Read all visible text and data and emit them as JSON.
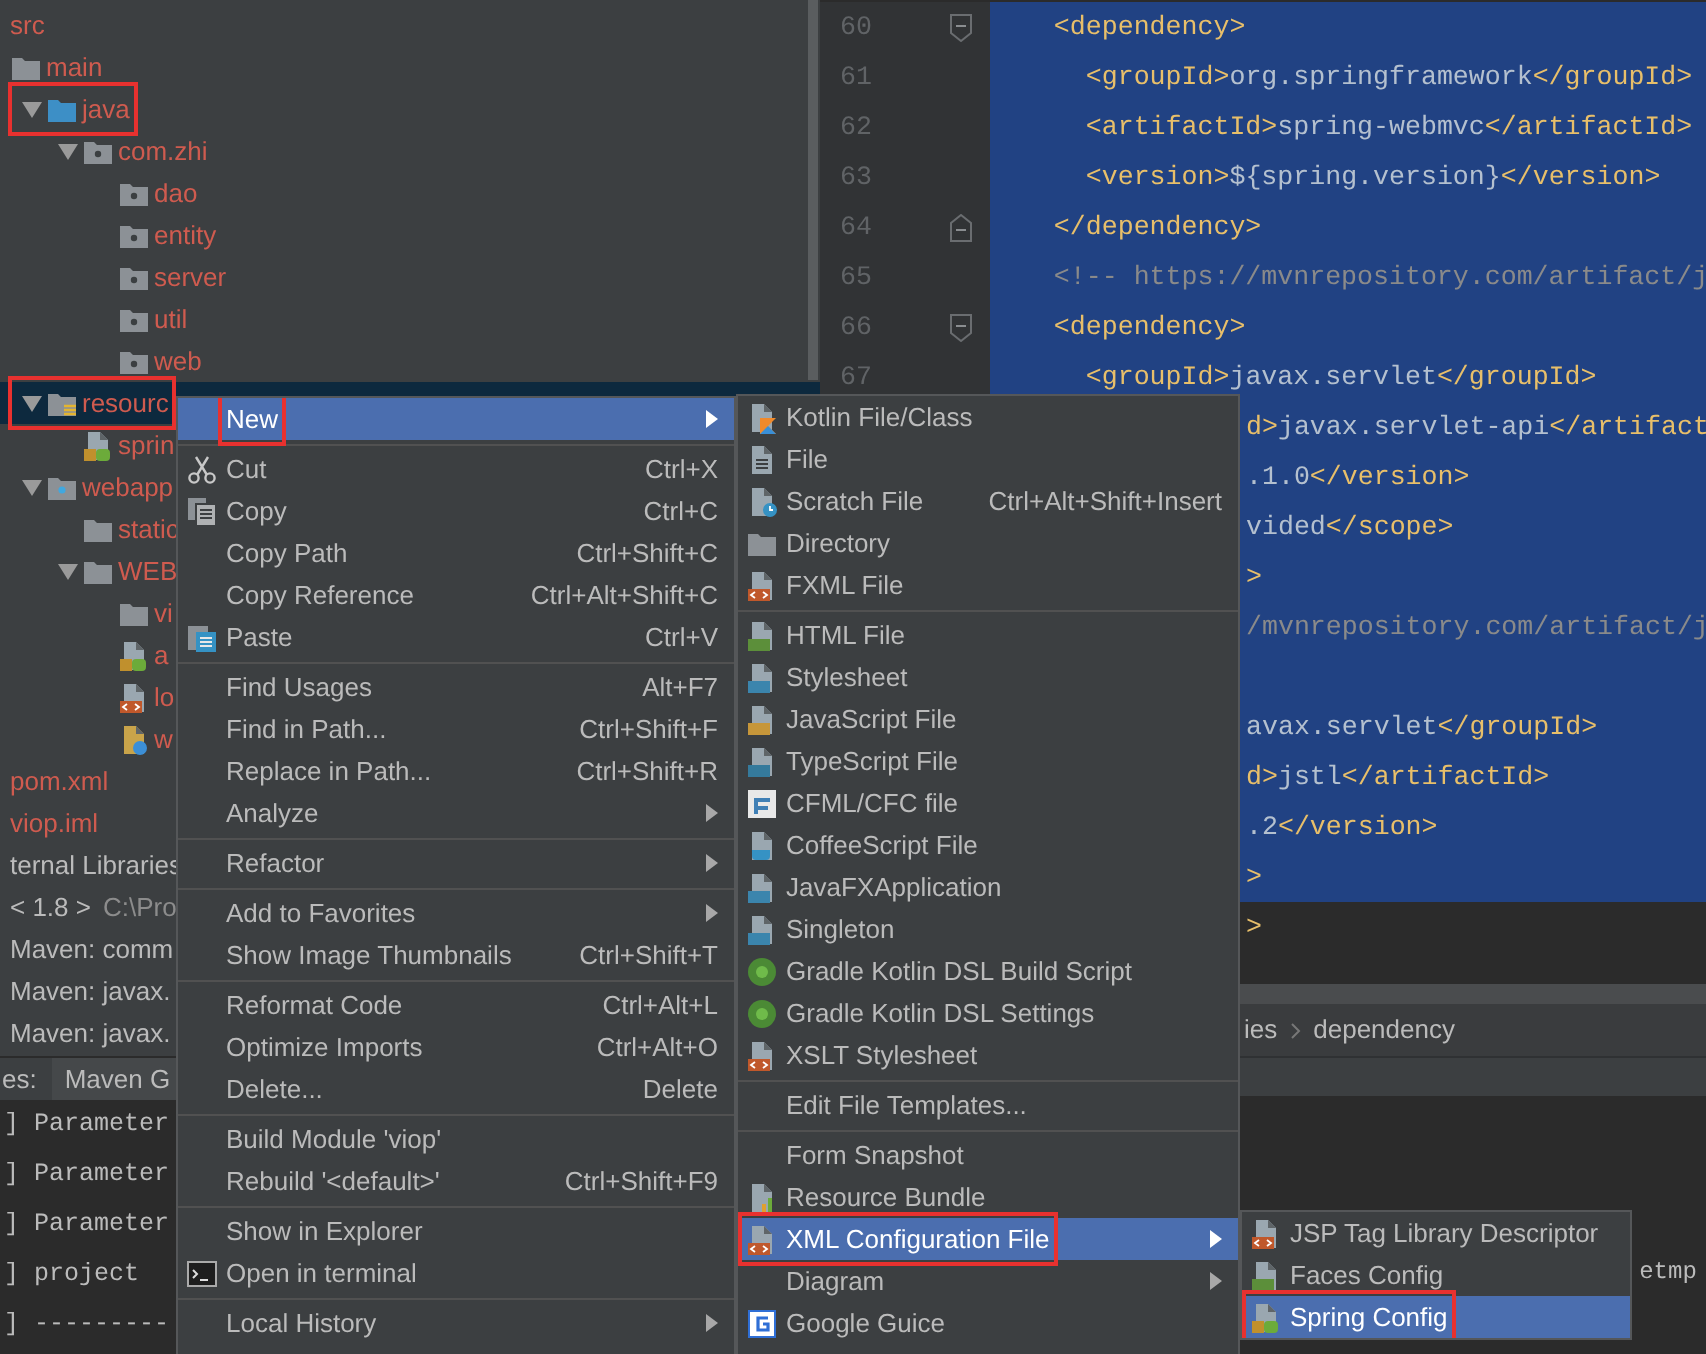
{
  "project_tree": {
    "items": [
      {
        "label": "src",
        "ignored": true,
        "selected": false,
        "boxed": false,
        "children": [
          {
            "label": "main",
            "kind": "folder",
            "ignored": true,
            "selected": false,
            "boxed": false,
            "children": [
              {
                "label": "java",
                "kind": "source",
                "ignored": true,
                "selected": false,
                "boxed": true,
                "children": [
                  {
                    "label": "com.zhi",
                    "kind": "package",
                    "ignored": true,
                    "selected": false,
                    "boxed": false,
                    "children": [
                      {
                        "label": "dao",
                        "kind": "package",
                        "ignored": true,
                        "selected": false,
                        "boxed": false
                      },
                      {
                        "label": "entity",
                        "kind": "package",
                        "ignored": true,
                        "selected": false,
                        "boxed": false
                      },
                      {
                        "label": "server",
                        "kind": "package",
                        "ignored": true,
                        "selected": false,
                        "boxed": false
                      },
                      {
                        "label": "util",
                        "kind": "package",
                        "ignored": true,
                        "selected": false,
                        "boxed": false
                      },
                      {
                        "label": "web",
                        "kind": "package",
                        "ignored": true,
                        "selected": false,
                        "boxed": false
                      }
                    ]
                  }
                ]
              },
              {
                "label": "resourc",
                "kind": "resources",
                "ignored": true,
                "selected": true,
                "boxed": true,
                "children": [
                  {
                    "label": "sprin",
                    "kind": "spring-xml",
                    "ignored": true,
                    "selected": false,
                    "boxed": false
                  }
                ]
              },
              {
                "label": "webapp",
                "kind": "web-folder",
                "ignored": true,
                "selected": false,
                "boxed": false,
                "children": [
                  {
                    "label": "static",
                    "kind": "folder",
                    "ignored": true,
                    "selected": false,
                    "boxed": false
                  },
                  {
                    "label": "WEB",
                    "kind": "folder",
                    "ignored": true,
                    "selected": false,
                    "boxed": false,
                    "children": [
                      {
                        "label": "vi",
                        "kind": "folder",
                        "ignored": true,
                        "selected": false,
                        "boxed": false
                      },
                      {
                        "label": "a",
                        "kind": "spring-xml",
                        "ignored": true,
                        "selected": false,
                        "boxed": false
                      },
                      {
                        "label": "lo",
                        "kind": "xml",
                        "ignored": true,
                        "selected": false,
                        "boxed": false
                      },
                      {
                        "label": "w",
                        "kind": "web-xml",
                        "ignored": true,
                        "selected": false,
                        "boxed": false
                      }
                    ]
                  }
                ]
              }
            ]
          }
        ]
      },
      {
        "label": "pom.xml",
        "ignored": true,
        "selected": false,
        "boxed": false
      },
      {
        "label": "viop.iml",
        "ignored": true,
        "selected": false,
        "boxed": false
      },
      {
        "label": "ternal Libraries",
        "ignored": false,
        "selected": false,
        "boxed": false
      },
      {
        "label": "< 1.8 >",
        "detail": "C:\\Pro",
        "ignored": false,
        "selected": false,
        "boxed": false
      },
      {
        "label": "Maven: comm",
        "ignored": false,
        "selected": false,
        "boxed": false
      },
      {
        "label": "Maven: javax.",
        "ignored": false,
        "selected": false,
        "boxed": false
      },
      {
        "label": "Maven: javax.",
        "ignored": false,
        "selected": false,
        "boxed": false
      }
    ]
  },
  "tool_tabs": {
    "prefix": "es:",
    "tab": "Maven G"
  },
  "editor": {
    "lines": [
      {
        "number": "60",
        "fold_start": true,
        "kind": "code",
        "text": "    <dependency>",
        "selected": true
      },
      {
        "number": "61",
        "kind": "code",
        "text": "      <groupId>org.springframework</groupId>",
        "selected": true
      },
      {
        "number": "62",
        "kind": "code",
        "text": "      <artifactId>spring-webmvc</artifactId>",
        "selected": true
      },
      {
        "number": "63",
        "kind": "code",
        "text": "      <version>${spring.version}</version>",
        "selected": true
      },
      {
        "number": "64",
        "fold_end": true,
        "kind": "code",
        "text": "    </dependency>",
        "selected": true
      },
      {
        "number": "65",
        "kind": "comment",
        "text": "    <!-- https://mvnrepository.com/artifact/j",
        "selected": true
      },
      {
        "number": "66",
        "fold_start": true,
        "kind": "code",
        "text": "    <dependency>",
        "selected": true
      },
      {
        "number": "67",
        "kind": "code",
        "text": "      <groupId>javax.servlet</groupId>",
        "selected": true
      },
      {
        "kind": "cut",
        "text": "d>javax.servlet-api</artifact",
        "selected": true
      },
      {
        "kind": "cut",
        "text": ".1.0</version>",
        "selected": true
      },
      {
        "kind": "cut",
        "text": "vided</scope>",
        "selected": true
      },
      {
        "kind": "cut",
        "text": ">",
        "selected": true
      },
      {
        "kind": "cut-comment",
        "text": "/mvnrepository.com/artifact/j",
        "selected": true
      },
      {
        "kind": "cut",
        "selected": true
      },
      {
        "kind": "cut",
        "text": "avax.servlet</groupId>",
        "selected": true
      },
      {
        "kind": "cut",
        "text": "d>jstl</artifactId>",
        "selected": true
      },
      {
        "kind": "cut",
        "text": ".2</version>",
        "selected": true
      },
      {
        "kind": "cut",
        "text": ">",
        "selected": true
      },
      {
        "kind": "cut",
        "text": ">",
        "selected": false
      }
    ]
  },
  "breadcrumbs": [
    "ies",
    "dependency"
  ],
  "console": {
    "lines": [
      {
        "left": "] Parameter"
      },
      {
        "left": "] Parameter"
      },
      {
        "left": "] Parameter"
      },
      {
        "left": "] project",
        "right": "etmp"
      },
      {
        "left": "] ---------"
      }
    ]
  },
  "context_menu": {
    "groups": [
      [
        {
          "label": "New",
          "submenu": true,
          "selected": true,
          "boxed": true
        }
      ],
      [
        {
          "label": "Cut",
          "kind": "cut",
          "shortcut": "Ctrl+X",
          "submenu": false,
          "selected": false,
          "boxed": false
        },
        {
          "label": "Copy",
          "kind": "copy",
          "shortcut": "Ctrl+C",
          "submenu": false,
          "selected": false,
          "boxed": false
        },
        {
          "label": "Copy Path",
          "shortcut": "Ctrl+Shift+C",
          "submenu": false,
          "selected": false,
          "boxed": false
        },
        {
          "label": "Copy Reference",
          "shortcut": "Ctrl+Alt+Shift+C",
          "submenu": false,
          "selected": false,
          "boxed": false
        },
        {
          "label": "Paste",
          "kind": "paste",
          "shortcut": "Ctrl+V",
          "submenu": false,
          "selected": false,
          "boxed": false
        }
      ],
      [
        {
          "label": "Find Usages",
          "shortcut": "Alt+F7",
          "submenu": false,
          "selected": false,
          "boxed": false
        },
        {
          "label": "Find in Path...",
          "shortcut": "Ctrl+Shift+F",
          "submenu": false,
          "selected": false,
          "boxed": false
        },
        {
          "label": "Replace in Path...",
          "shortcut": "Ctrl+Shift+R",
          "submenu": false,
          "selected": false,
          "boxed": false
        },
        {
          "label": "Analyze",
          "submenu": true,
          "selected": false,
          "boxed": false
        }
      ],
      [
        {
          "label": "Refactor",
          "submenu": true,
          "selected": false,
          "boxed": false
        }
      ],
      [
        {
          "label": "Add to Favorites",
          "submenu": true,
          "selected": false,
          "boxed": false
        },
        {
          "label": "Show Image Thumbnails",
          "shortcut": "Ctrl+Shift+T",
          "submenu": false,
          "selected": false,
          "boxed": false
        }
      ],
      [
        {
          "label": "Reformat Code",
          "shortcut": "Ctrl+Alt+L",
          "submenu": false,
          "selected": false,
          "boxed": false
        },
        {
          "label": "Optimize Imports",
          "shortcut": "Ctrl+Alt+O",
          "submenu": false,
          "selected": false,
          "boxed": false
        },
        {
          "label": "Delete...",
          "shortcut": "Delete",
          "submenu": false,
          "selected": false,
          "boxed": false
        }
      ],
      [
        {
          "label": "Build Module 'viop'",
          "submenu": false,
          "selected": false,
          "boxed": false
        },
        {
          "label": "Rebuild '<default>'",
          "shortcut": "Ctrl+Shift+F9",
          "submenu": false,
          "selected": false,
          "boxed": false
        }
      ],
      [
        {
          "label": "Show in Explorer",
          "submenu": false,
          "selected": false,
          "boxed": false
        },
        {
          "label": "Open in terminal",
          "kind": "terminal",
          "submenu": false,
          "selected": false,
          "boxed": false
        }
      ],
      [
        {
          "label": "Local History",
          "submenu": true,
          "selected": false,
          "boxed": false
        }
      ]
    ]
  },
  "new_submenu": {
    "groups": [
      [
        {
          "label": "Kotlin File/Class",
          "kind": "kotlin",
          "submenu": false,
          "selected": false,
          "boxed": false
        },
        {
          "label": "File",
          "kind": "file",
          "submenu": false,
          "selected": false,
          "boxed": false
        },
        {
          "label": "Scratch File",
          "kind": "scratch",
          "shortcut": "Ctrl+Alt+Shift+Insert",
          "submenu": false,
          "selected": false,
          "boxed": false
        },
        {
          "label": "Directory",
          "kind": "folder",
          "submenu": false,
          "selected": false,
          "boxed": false
        },
        {
          "label": "FXML File",
          "kind": "xml",
          "submenu": false,
          "selected": false,
          "boxed": false
        }
      ],
      [
        {
          "label": "HTML File",
          "kind": "html",
          "submenu": false,
          "selected": false,
          "boxed": false
        },
        {
          "label": "Stylesheet",
          "kind": "css",
          "submenu": false,
          "selected": false,
          "boxed": false
        },
        {
          "label": "JavaScript File",
          "kind": "js",
          "submenu": false,
          "selected": false,
          "boxed": false
        },
        {
          "label": "TypeScript File",
          "kind": "ts",
          "submenu": false,
          "selected": false,
          "boxed": false
        },
        {
          "label": "CFML/CFC file",
          "kind": "cf",
          "submenu": false,
          "selected": false,
          "boxed": false
        },
        {
          "label": "CoffeeScript File",
          "kind": "coffee",
          "submenu": false,
          "selected": false,
          "boxed": false
        },
        {
          "label": "JavaFXApplication",
          "kind": "javafx",
          "submenu": false,
          "selected": false,
          "boxed": false
        },
        {
          "label": "Singleton",
          "kind": "javafx",
          "submenu": false,
          "selected": false,
          "boxed": false
        },
        {
          "label": "Gradle Kotlin DSL Build Script",
          "kind": "gradle",
          "submenu": false,
          "selected": false,
          "boxed": false
        },
        {
          "label": "Gradle Kotlin DSL Settings",
          "kind": "gradle",
          "submenu": false,
          "selected": false,
          "boxed": false
        },
        {
          "label": "XSLT Stylesheet",
          "kind": "xml",
          "submenu": false,
          "selected": false,
          "boxed": false
        }
      ],
      [
        {
          "label": "Edit File Templates...",
          "submenu": false,
          "selected": false,
          "boxed": false
        }
      ],
      [
        {
          "label": "Form Snapshot",
          "submenu": false,
          "selected": false,
          "boxed": false
        },
        {
          "label": "Resource Bundle",
          "kind": "bundle",
          "submenu": false,
          "selected": false,
          "boxed": false
        },
        {
          "label": "XML Configuration File",
          "kind": "xml",
          "submenu": true,
          "selected": true,
          "boxed": true
        },
        {
          "label": "Diagram",
          "submenu": true,
          "selected": false,
          "boxed": false
        },
        {
          "label": "Google Guice",
          "kind": "guice",
          "submenu": false,
          "selected": false,
          "boxed": false
        }
      ]
    ]
  },
  "xml_submenu": {
    "groups": [
      [
        {
          "label": "JSP Tag Library Descriptor",
          "kind": "xml",
          "submenu": false,
          "selected": false,
          "boxed": false
        },
        {
          "label": "Faces Config",
          "kind": "faces",
          "submenu": false,
          "selected": false,
          "boxed": false
        },
        {
          "label": "Spring Config",
          "kind": "spring-xml",
          "submenu": false,
          "selected": true,
          "boxed": true
        }
      ]
    ]
  }
}
